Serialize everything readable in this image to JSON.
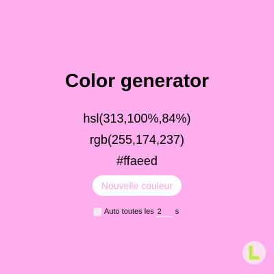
{
  "page": {
    "title": "Color generator",
    "background_color": "#ffaeed"
  },
  "color": {
    "hsl": "hsl(313,100%,84%)",
    "rgb": "rgb(255,174,237)",
    "hex": "#ffaeed"
  },
  "controls": {
    "new_color_label": "Nouvelle couleur",
    "auto_label": "Auto toutes les",
    "auto_checked": false,
    "interval_value": "2",
    "interval_unit": "s"
  },
  "logo": {
    "icon": "l-logo-icon",
    "colors": [
      "#7ee27e",
      "#f6f05a"
    ]
  }
}
